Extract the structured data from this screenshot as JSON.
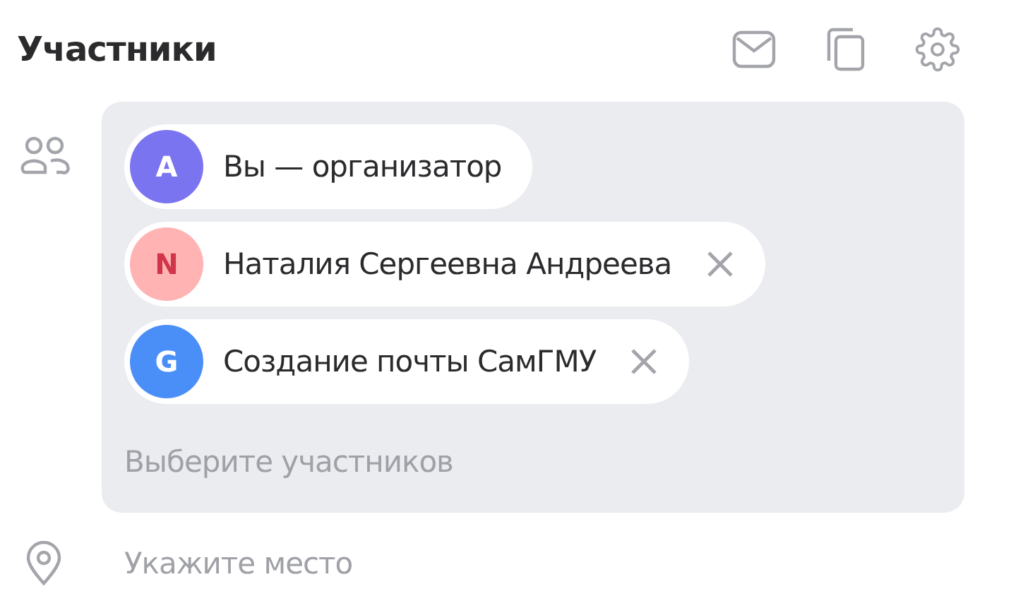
{
  "title": "Участники",
  "participants": [
    {
      "initial": "A",
      "name": "Вы — организатор",
      "color": "#7b74f0",
      "removable": false
    },
    {
      "initial": "N",
      "name": "Наталия Сергеевна Андреева",
      "color": "#ffb3b3",
      "removable": true
    },
    {
      "initial": "G",
      "name": "Создание почты СамГМУ",
      "color": "#4a8ff7",
      "removable": true
    }
  ],
  "participants_placeholder": "Выберите участников",
  "location_placeholder": "Укажите место"
}
